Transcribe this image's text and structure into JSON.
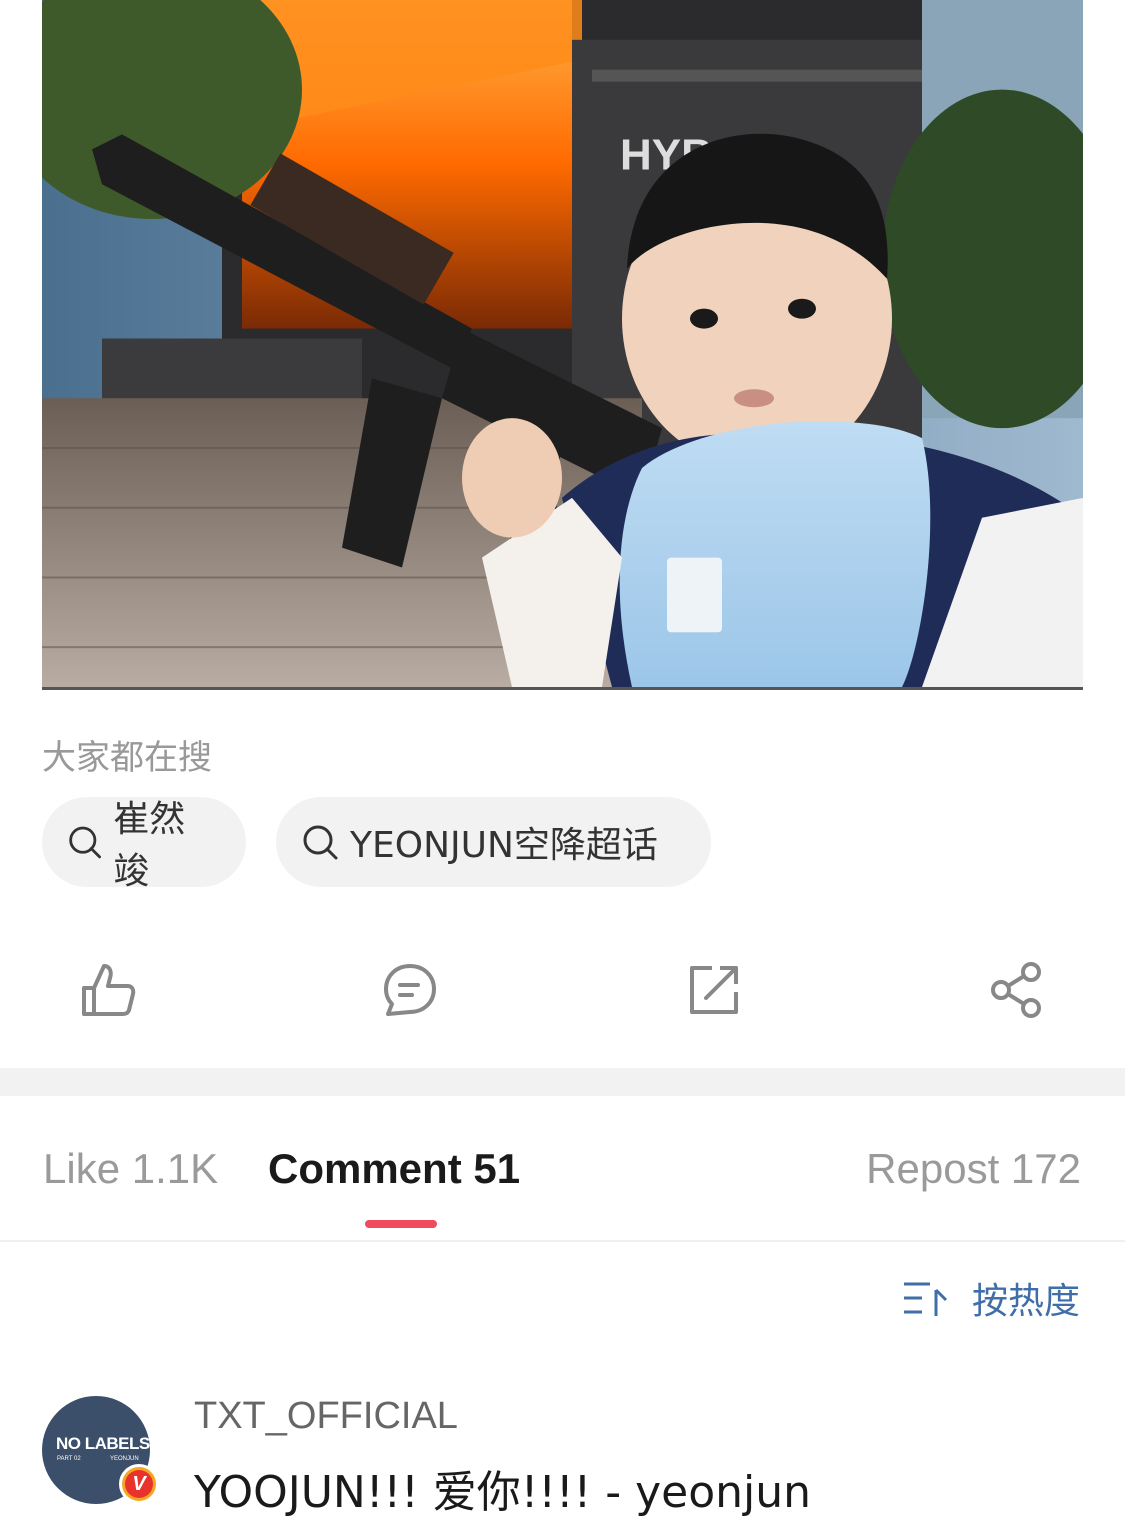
{
  "hot_search": {
    "title": "大家都在搜",
    "items": [
      "崔然竣",
      "YEONJUN空降超话"
    ]
  },
  "post_image": {
    "building_sign": "HYB"
  },
  "actions": {
    "icons": [
      "thumbs-up-icon",
      "comment-icon",
      "repost-icon",
      "share-icon"
    ]
  },
  "tabs": {
    "like": "Like 1.1K",
    "comment": "Comment 51",
    "repost": "Repost 172",
    "active": "comment"
  },
  "sort": {
    "label": "按热度"
  },
  "comment": {
    "avatar_text": "NO LABELS",
    "avatar_sub_left": "PART 02",
    "avatar_sub_right": "YEONJUN",
    "badge": "V",
    "username": "TXT_OFFICIAL",
    "text": "YOOJUN!!! 爱你!!!! - yeonjun"
  },
  "colors": {
    "accent": "#f04c5e",
    "link": "#3f6ea8",
    "chip_bg": "#f2f2f2"
  }
}
